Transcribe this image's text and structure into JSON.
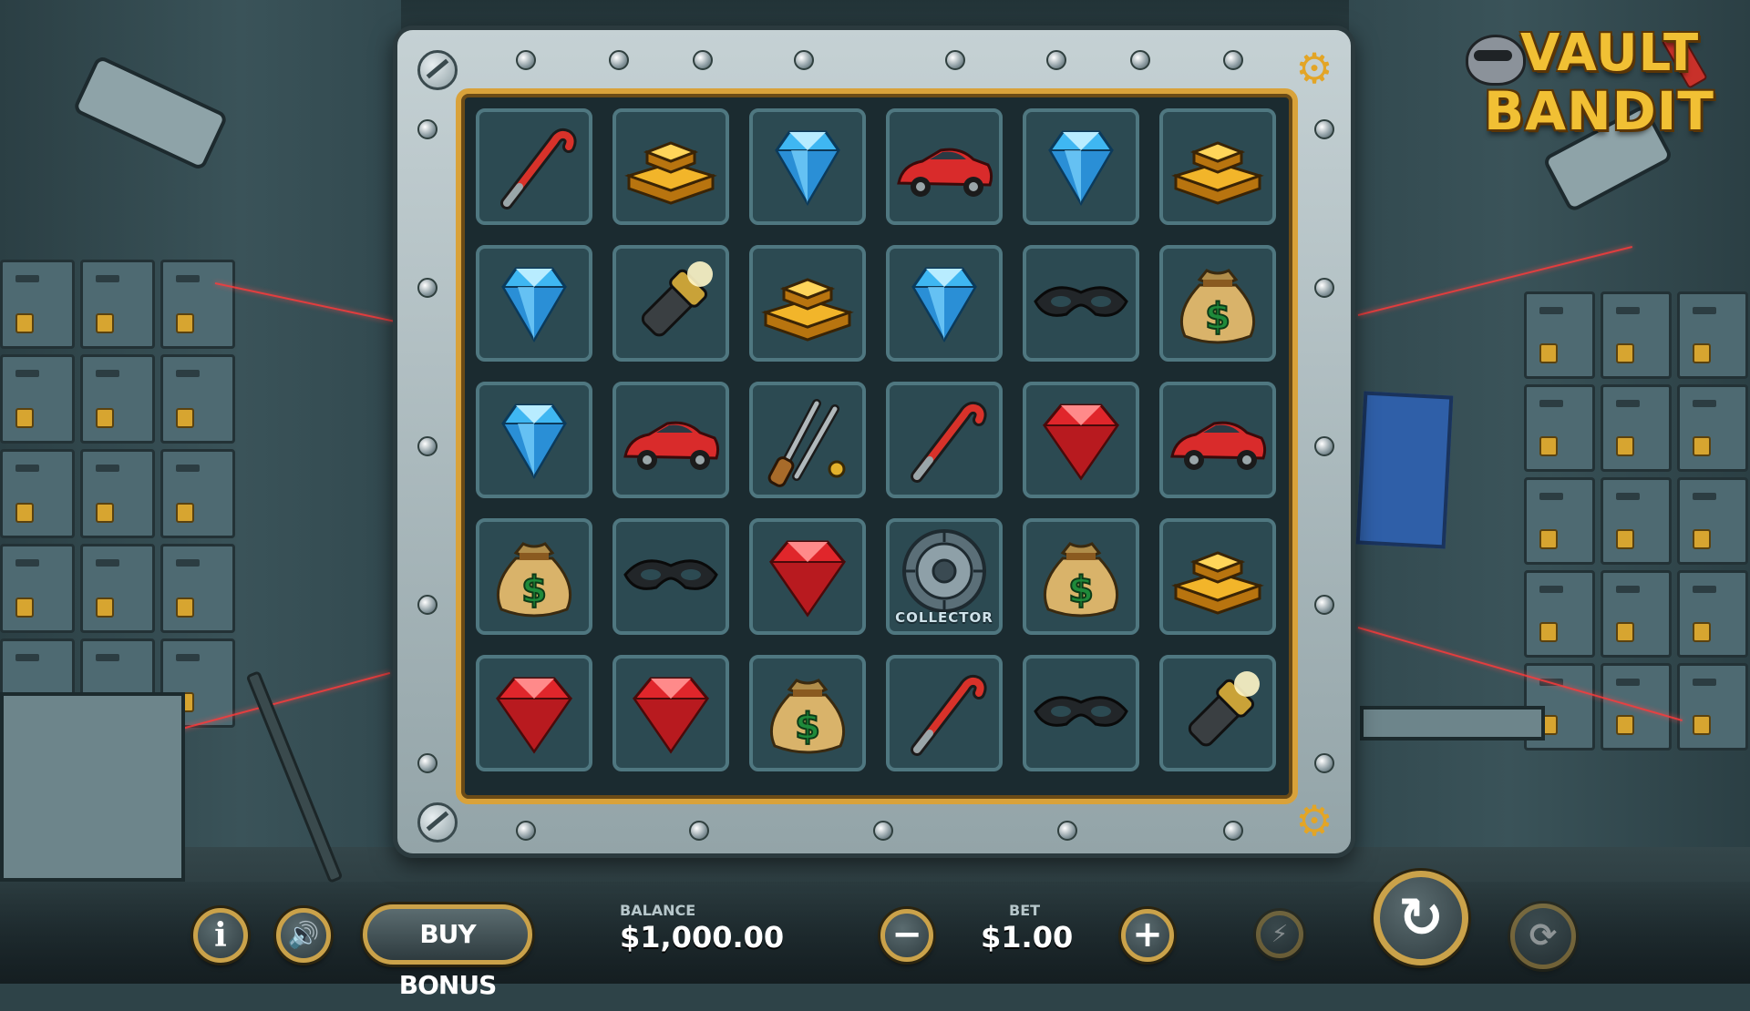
{
  "logo": {
    "line1": "VAULT",
    "line2": "BANDIT"
  },
  "grid": {
    "rows": [
      [
        "crowbar",
        "gold-bars",
        "blue-diamond",
        "red-car",
        "blue-diamond",
        "gold-bars"
      ],
      [
        "blue-diamond",
        "flashlight",
        "gold-bars",
        "blue-diamond",
        "mask",
        "money-bag"
      ],
      [
        "blue-diamond",
        "red-car",
        "lockpick-tools",
        "crowbar",
        "ruby",
        "red-car"
      ],
      [
        "money-bag",
        "mask",
        "ruby",
        "collector",
        "money-bag",
        "gold-bars"
      ],
      [
        "ruby",
        "ruby",
        "money-bag",
        "crowbar",
        "mask",
        "flashlight"
      ]
    ],
    "collector_label": "COLLECTOR"
  },
  "controls": {
    "buy_bonus_label": "BUY BONUS",
    "balance_label": "BALANCE",
    "balance_value": "$1,000.00",
    "bet_label": "BET",
    "bet_value": "$1.00",
    "info_icon": "info-icon",
    "sound_icon": "sound-icon",
    "minus_icon": "minus-icon",
    "plus_icon": "plus-icon",
    "turbo_icon": "lightning-icon",
    "spin_icon": "spin-icon",
    "autoplay_icon": "autoplay-icon"
  },
  "colors": {
    "accent_gold": "#d9a23a",
    "cell_bg": "#2c4a52",
    "logo_text": "#f1c034"
  }
}
